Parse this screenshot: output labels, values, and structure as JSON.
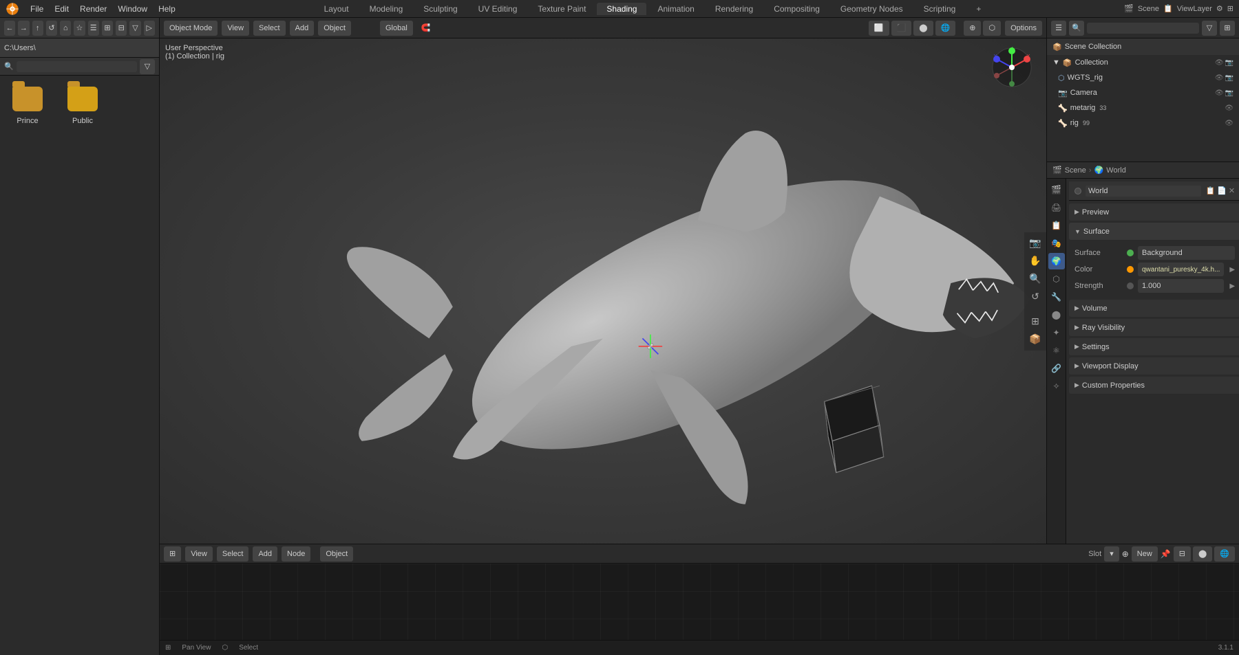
{
  "app": {
    "title": "Blender",
    "version": "3.1.1"
  },
  "top_menu": {
    "items": [
      "Blender",
      "File",
      "Edit",
      "Render",
      "Window",
      "Help"
    ],
    "tabs": [
      "Layout",
      "Modeling",
      "Sculpting",
      "UV Editing",
      "Texture Paint",
      "Shading",
      "Animation",
      "Rendering",
      "Compositing",
      "Geometry Nodes",
      "Scripting",
      "+"
    ],
    "active_tab": "Shading",
    "right_controls": {
      "scene": "Scene",
      "view_layer": "ViewLayer"
    }
  },
  "left_panel": {
    "path": "C:\\Users\\",
    "files": [
      {
        "name": "Prince",
        "type": "folder"
      },
      {
        "name": "Public",
        "type": "folder"
      }
    ]
  },
  "viewport": {
    "mode": "Object Mode",
    "view": "View",
    "select": "Select",
    "add": "Add",
    "object": "Object",
    "shading": "Shading",
    "global": "Global",
    "overlay_label": "User Perspective",
    "collection_label": "(1) Collection | rig",
    "options_label": "Options"
  },
  "outliner": {
    "title": "Scene Collection",
    "items": [
      {
        "name": "Collection",
        "depth": 0,
        "type": "collection",
        "expanded": true
      },
      {
        "name": "WGTS_rig",
        "depth": 1,
        "type": "mesh"
      },
      {
        "name": "Camera",
        "depth": 1,
        "type": "camera"
      },
      {
        "name": "metarig",
        "depth": 1,
        "type": "armature",
        "suffix": "33"
      },
      {
        "name": "rig",
        "depth": 1,
        "type": "armature",
        "suffix": "99"
      }
    ]
  },
  "properties_panel": {
    "breadcrumb_scene": "Scene",
    "breadcrumb_world": "World",
    "world_name": "World",
    "world_label": "World",
    "sections": {
      "preview": {
        "label": "Preview",
        "expanded": false
      },
      "surface": {
        "label": "Surface",
        "expanded": true,
        "surface_label": "Surface",
        "surface_value": "Background",
        "color_label": "Color",
        "color_value": "qwantani_puresky_4k.h...",
        "strength_label": "Strength",
        "strength_value": "1.000"
      },
      "volume": {
        "label": "Volume",
        "expanded": false
      },
      "ray_visibility": {
        "label": "Ray Visibility",
        "expanded": false
      },
      "settings": {
        "label": "Settings",
        "expanded": false
      },
      "viewport_display": {
        "label": "Viewport Display",
        "expanded": false
      },
      "custom_properties": {
        "label": "Custom Properties",
        "expanded": false
      }
    },
    "icons": [
      "render",
      "output",
      "view_layer",
      "scene",
      "world",
      "object",
      "object_data",
      "material",
      "particles",
      "physics",
      "constraints",
      "modifiers",
      "shaderfx"
    ]
  },
  "bottom_editor": {
    "mode": "Object",
    "view": "View",
    "select": "Select",
    "add": "Add",
    "node": "Node",
    "slot": "Slot",
    "new": "New",
    "pan_view_label": "Pan View",
    "select_label": "Select"
  },
  "icons": {
    "folder": "📁",
    "camera": "📷",
    "mesh": "⬡",
    "armature": "🦴",
    "collection": "📦",
    "chevron_right": "▶",
    "chevron_down": "▼",
    "search": "🔍",
    "dot": "●",
    "eye": "👁",
    "render": "🎬",
    "world": "🌍",
    "scene": "🎬",
    "object": "⬡",
    "material": "⬤",
    "close": "✕",
    "new_doc": "📄",
    "pin": "📌"
  }
}
